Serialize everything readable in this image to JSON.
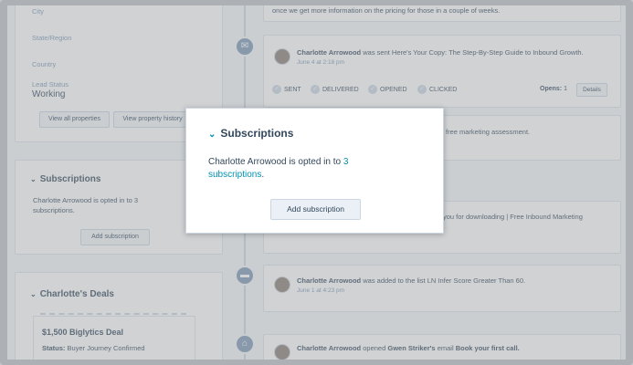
{
  "sidebar": {
    "fields": [
      {
        "label": "City",
        "value": ""
      },
      {
        "label": "State/Region",
        "value": ""
      },
      {
        "label": "Country",
        "value": ""
      },
      {
        "label": "Lead Status",
        "value": "Working"
      }
    ],
    "view_all_label": "View all properties",
    "view_history_label": "View property history",
    "subscriptions": {
      "title": "Subscriptions",
      "text": "Charlotte Arrowood is opted in to 3 subscriptions.",
      "add_label": "Add subscription"
    },
    "deals": {
      "title": "Charlotte's Deals",
      "deal_name": "$1,500 Biglytics Deal",
      "status_label": "Status:",
      "status_value": "Buyer Journey Confirmed"
    }
  },
  "timeline": {
    "top_text": "once we get more information on the pricing for those in a couple of weeks.",
    "email_event": {
      "actor": "Charlotte Arrowood",
      "action": "was sent Here's Your Copy: The Step-By-Step Guide to Inbound Growth.",
      "date": "June 4 at 2:18 pm",
      "statuses": [
        "SENT",
        "DELIVERED",
        "OPENED",
        "CLICKED"
      ],
      "opens_label": "Opens:",
      "opens_value": "1",
      "details_label": "Details"
    },
    "partial_event_1": "free marketing assessment.",
    "partial_event_2": "you for downloading | Free Inbound Marketing",
    "list_event": {
      "actor": "Charlotte Arrowood",
      "action": "was added to the list LN Infer Score Greater Than 60.",
      "date": "June 1 at 4:23 pm"
    },
    "open_event": {
      "actor": "Charlotte Arrowood",
      "action_1": "opened",
      "target": "Gwen Striker's",
      "action_2": "email",
      "email_subject": "Book your first call."
    }
  },
  "modal": {
    "title": "Subscriptions",
    "text_prefix": "Charlotte Arrowood is opted in to",
    "count": "3",
    "text_link": "subscriptions",
    "text_suffix": ".",
    "add_label": "Add subscription"
  },
  "colors": {
    "accent": "#0091ae",
    "text": "#33475b",
    "muted": "#7c98b6",
    "border": "#cbd6e2"
  }
}
